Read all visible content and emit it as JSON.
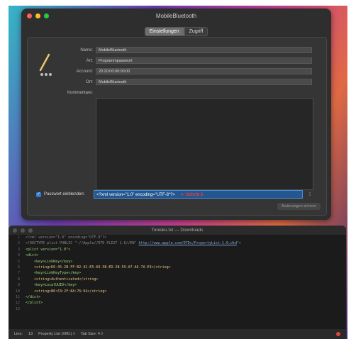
{
  "keychain": {
    "title": "MobileBluetooth",
    "tabs": [
      "Einstellungen",
      "Zugriff"
    ],
    "fields": [
      {
        "label": "Name:",
        "value": "MobileBluetooth"
      },
      {
        "label": "Art:",
        "value": "Programmpasswort"
      },
      {
        "label": "Account:",
        "value": "20:20:00:00:00:00"
      },
      {
        "label": "Ort:",
        "value": "MobileBluetooth"
      }
    ],
    "comment_label": "Kommentare:",
    "show_password_label": "Passwort einblenden:",
    "password_value": "<?xml version=\"1.0\" encoding=\"UTF-8\"?>",
    "password_annotation": "<- Schritt 3",
    "save_label": "Änderungen sichern"
  },
  "editor": {
    "title": "Tonisko.txt — Downloads",
    "lines": [
      [
        "<?xml version=\"1.0\" encoding=\"UTF-8\"?>"
      ],
      [
        "<!DOCTYPE plist PUBLIC \"-//Apple//DTD PLIST 1.0//EN\" ",
        "http://www.apple.com/DTDs/PropertyList-1.0.dtd",
        "\">"
      ],
      [
        "<plist version=\"1.0\">"
      ],
      [
        "<dict>"
      ],
      [
        "    <key>LinkKey</key>"
      ],
      [
        "    <string>D6-45-2B-FF-B2-42-E5-69-5B-ED-2B-59-A7-A6-7A-E3</string>"
      ],
      [
        "    <key>LinkKeyType</key>"
      ],
      [
        "    <string>Authenticated</string>"
      ],
      [
        "    <key>LocalUUID</key>"
      ],
      [
        "    <string>B0:63:2F:8A:76:94</string>"
      ],
      [
        "</dict>"
      ],
      [
        "</plist>"
      ],
      [
        ""
      ]
    ],
    "status": {
      "line_label": "Line:",
      "line_value": "13",
      "syntax": "Property List (XML) ◊",
      "tab_size": "Tab Size: 4 ◊"
    }
  }
}
